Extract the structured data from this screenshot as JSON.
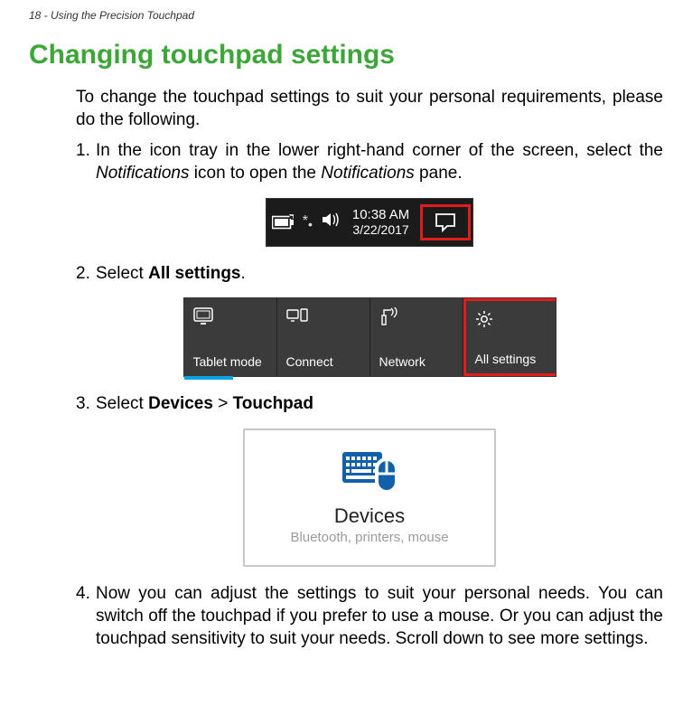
{
  "page_header": "18 - Using the Precision Touchpad",
  "section_title": "Changing touchpad settings",
  "intro": "To change the touchpad settings to suit your personal requirements, please do the following.",
  "steps": {
    "s1_a": "In the icon tray in the lower right-hand corner of the screen, select the ",
    "s1_notifications": "Notifications",
    "s1_b": " icon to open the ",
    "s1_c": " pane.",
    "s2_a": "Select ",
    "s2_bold": "All settings",
    "s2_b": ".",
    "s3_a": "Select ",
    "s3_bold1": "Devices",
    "s3_sep": " > ",
    "s3_bold2": "Touchpad",
    "s4": "Now you can adjust the settings to suit your personal needs. You can switch off the touchpad if you prefer to use a mouse. Or you can adjust the touchpad sensitivity to suit your needs. Scroll down to see more settings."
  },
  "tray": {
    "time": "10:38 AM",
    "date": "3/22/2017"
  },
  "quick_actions": {
    "t1": "Tablet mode",
    "t2": "Connect",
    "t3": "Network",
    "t4": "All settings"
  },
  "devices_tile": {
    "title": "Devices",
    "subtitle": "Bluetooth, printers, mouse"
  }
}
